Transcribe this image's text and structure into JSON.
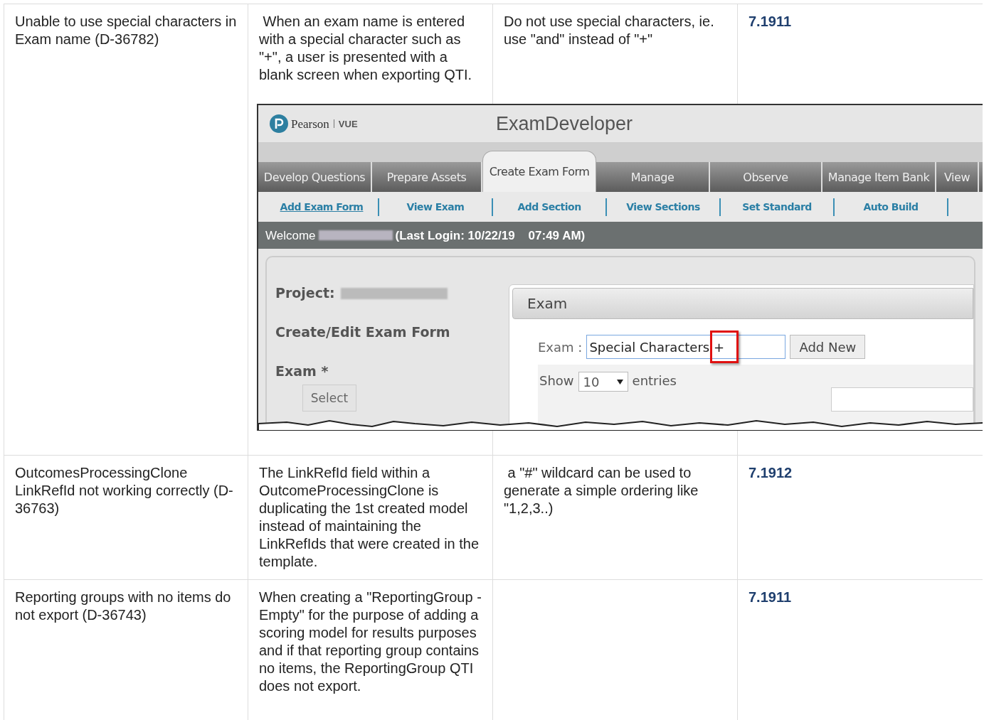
{
  "rows": [
    {
      "issue": "Unable to use special characters in Exam name (D-36782)",
      "description": " When an exam name is entered with a special character such as \"+\", a user is presented with a blank screen when exporting QTI.",
      "workaround": "Do not use special characters, ie. use \"and\" instead of \"+\"",
      "version": "7.1911",
      "screenshot": {
        "logo_name": "Pearson",
        "logo_sub": "VUE",
        "app_title": "ExamDeveloper",
        "tabs": [
          {
            "label": "Develop Questions",
            "selected": false
          },
          {
            "label": "Prepare Assets",
            "selected": false
          },
          {
            "label": "Create Exam Form",
            "selected": true
          },
          {
            "label": "Manage",
            "selected": false
          },
          {
            "label": "Observe",
            "selected": false
          },
          {
            "label": "Manage Item Bank",
            "selected": false
          },
          {
            "label": "View",
            "selected": false
          }
        ],
        "subnav": [
          {
            "label": "Add Exam Form",
            "selected": true
          },
          {
            "label": "View Exam",
            "selected": false
          },
          {
            "label": "Add Section",
            "selected": false
          },
          {
            "label": "View Sections",
            "selected": false
          },
          {
            "label": "Set Standard",
            "selected": false
          },
          {
            "label": "Auto Build",
            "selected": false
          }
        ],
        "welcome": "Welcome",
        "last_login": "(Last Login: 10/22/19    07:49 AM)",
        "project_label": "Project:",
        "form_title": "Create/Edit Exam Form",
        "exam_label": "Exam *",
        "select_button": "Select",
        "panel_title": "Exam",
        "exam_field_label": "Exam :",
        "exam_field_value": "Special Characters +",
        "add_new_button": "Add New",
        "show_label": "Show",
        "entries_value": "10",
        "entries_label": "entries"
      }
    },
    {
      "issue": "OutcomesProcessingClone LinkRefId not working correctly (D-36763)",
      "description": "The LinkRefId field within a OutcomeProcessingClone is duplicating the 1st created model instead of maintaining the LinkRefIds that were created in the template.",
      "workaround": " a \"#\" wildcard can be used to generate a simple ordering like \"1,2,3..)",
      "version": "7.1912"
    },
    {
      "issue": "Reporting groups with no items do not export (D-36743)",
      "description": "When creating a \"ReportingGroup - Empty\" for the purpose of adding a scoring model for results purposes and if that reporting group contains no items, the ReportingGroup QTI does not export.",
      "version": "7.1911"
    }
  ]
}
